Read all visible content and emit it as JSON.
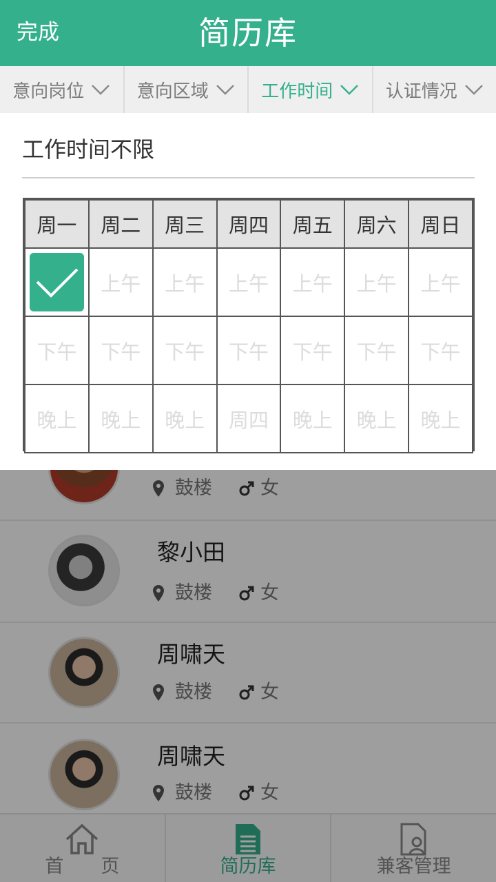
{
  "header": {
    "done_label": "完成",
    "title": "简历库"
  },
  "filters": [
    {
      "label": "意向岗位",
      "active": false
    },
    {
      "label": "意向区域",
      "active": false
    },
    {
      "label": "工作时间",
      "active": true
    },
    {
      "label": "认证情况",
      "active": false
    }
  ],
  "panel": {
    "unlimited_label": "工作时间不限",
    "days": [
      "周一",
      "周二",
      "周三",
      "周四",
      "周五",
      "周六",
      "周日"
    ],
    "rows": [
      [
        "",
        "上午",
        "上午",
        "上午",
        "上午",
        "上午",
        "上午"
      ],
      [
        "下午",
        "下午",
        "下午",
        "下午",
        "下午",
        "下午",
        "下午"
      ],
      [
        "晚上",
        "晚上",
        "晚上",
        "周四",
        "晚上",
        "晚上",
        "晚上"
      ]
    ],
    "checked": "周一 上午"
  },
  "list": [
    {
      "name": "",
      "district": "鼓楼",
      "gender": "女"
    },
    {
      "name": "黎小田",
      "district": "鼓楼",
      "gender": "女"
    },
    {
      "name": "周啸天",
      "district": "鼓楼",
      "gender": "女"
    },
    {
      "name": "周啸天",
      "district": "鼓楼",
      "gender": "女"
    }
  ],
  "tabs": [
    {
      "label": "首　　页",
      "icon": "home-icon",
      "active": false
    },
    {
      "label": "简历库",
      "icon": "document-icon",
      "active": true
    },
    {
      "label": "兼客管理",
      "icon": "profile-document-icon",
      "active": false
    }
  ],
  "colors": {
    "accent": "#35b08d",
    "filter_bg": "#efefef"
  }
}
